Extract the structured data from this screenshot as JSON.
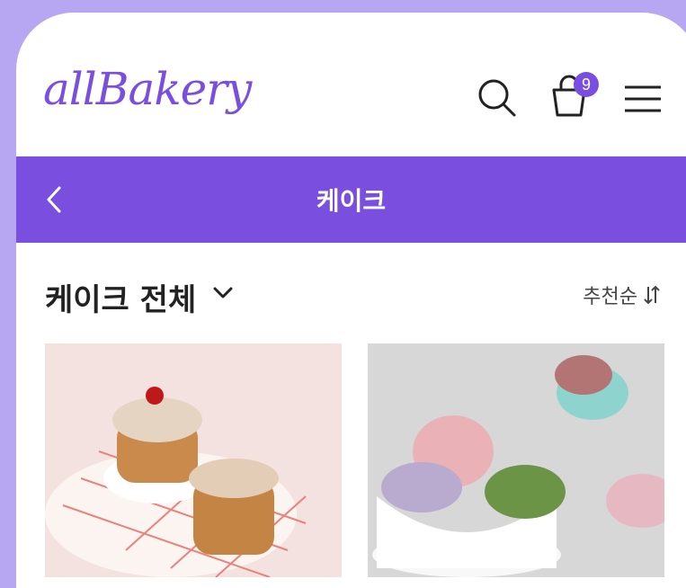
{
  "header": {
    "logo_text": "allBakery",
    "cart_count": "9",
    "icons": [
      "search-icon",
      "cart-icon",
      "menu-icon"
    ]
  },
  "titlebar": {
    "title": "케이크",
    "back_icon": "chevron-left-icon"
  },
  "filter": {
    "category_label": "케이크 전체",
    "sort_label": "추천순"
  },
  "products": [
    {
      "image": "cream-puff-cakes"
    },
    {
      "image": "macarons-in-cup"
    }
  ],
  "colors": {
    "accent": "#7a4fe0",
    "background": "#b7a7f2"
  }
}
